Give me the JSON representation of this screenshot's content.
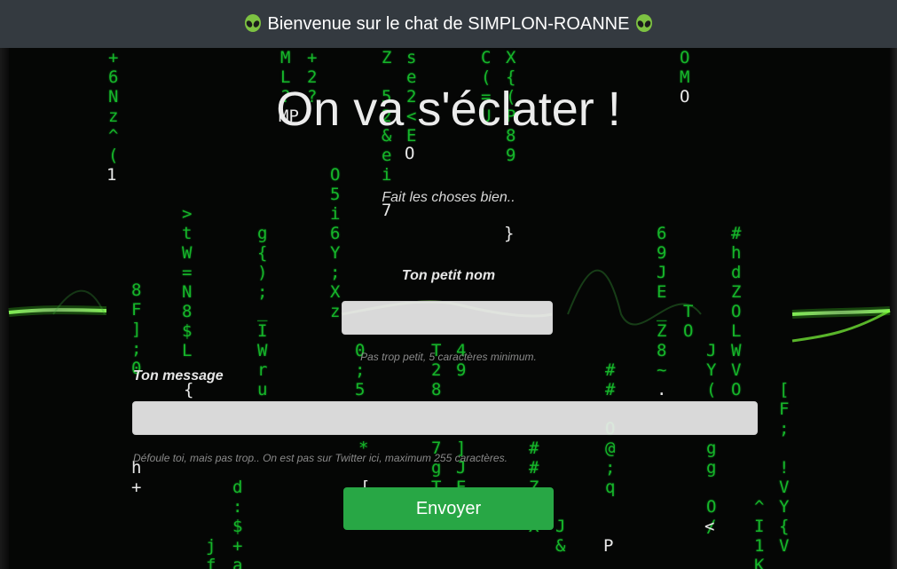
{
  "header": {
    "title": "Bienvenue sur le chat de SIMPLON-ROANNE",
    "left_icon": "alien-emoji",
    "right_icon": "alien-emoji"
  },
  "main": {
    "heading": "On va s'éclater !",
    "tagline": "Fait les choses bien.."
  },
  "form": {
    "name_label": "Ton petit nom",
    "name_value": "",
    "name_help": "Pas trop petit, 5 caractères minimum.",
    "message_label": "Ton message",
    "message_value": "",
    "message_help": "Défoule toi, mais pas trop.. On est pas sur Twitter ici, maximum 255 caractères.",
    "submit_label": "Envoyer"
  },
  "colors": {
    "header_bg": "#343a40",
    "accent_green": "#28a745",
    "matrix_green": "#16b52a"
  }
}
